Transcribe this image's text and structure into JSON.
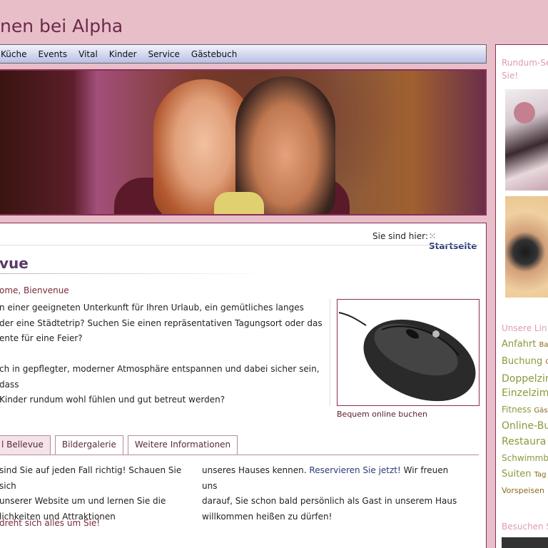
{
  "site": {
    "title": "nen bei Alpha"
  },
  "nav": {
    "items": [
      "Küche",
      "Events",
      "Vital",
      "Kinder",
      "Service",
      "Gästebuch"
    ]
  },
  "breadcrumb": {
    "label": "Sie sind hier:",
    "link": "Startseite"
  },
  "page": {
    "title": "vue",
    "subheading": "ome, Bienvenue",
    "intro_lines": [
      "n einer geeigneten Unterkunft für Ihren Urlaub, ein gemütliches langes",
      "der eine Städtetrip? Suchen Sie einen repräsentativen Tagungsort oder das",
      "ente für eine Feier?",
      "",
      "ch in gepflegter, moderner Atmosphäre entspannen und dabei sicher sein, dass",
      "Kinder rundum wohl fühlen und gut betreut werden?"
    ],
    "image_caption": "Bequem online buchen"
  },
  "tabs": [
    {
      "label": "l Bellevue",
      "active": true
    },
    {
      "label": "Bildergalerie",
      "active": false
    },
    {
      "label": "Weitere Informationen",
      "active": false
    }
  ],
  "tab_content": {
    "left_lines": [
      "sind Sie auf jeden Fall richtig! Schauen Sie sich",
      " unserer Website um und lernen Sie die",
      "lichkeiten und Attraktionen"
    ],
    "right_line1_prefix": "unseres Hauses kennen. ",
    "right_link": "Reservieren Sie jetzt!",
    "right_line1_suffix": " Wir freuen uns",
    "right_lines": [
      "darauf, Sie schon bald persönlich als Gast in unserem Haus",
      "willkommen heißen zu dürfen!"
    ],
    "tagline": "dreht sich alles um Sie!"
  },
  "sidebar": {
    "heading1_line1": "Rundum-Se",
    "heading1_line2": "Sie!",
    "heading2": "Unsere Lin",
    "heading3": "Besuchen S",
    "tags": [
      {
        "main": "Anfahrt",
        "small": "Ba"
      },
      {
        "main": "Buchung",
        "small": "O"
      },
      {
        "main": "Doppelzim",
        "small": ""
      },
      {
        "main": "Einzelzimm",
        "small": ""
      },
      {
        "main": "Fitness",
        "small": "Gäste"
      },
      {
        "main": "Online-Bu",
        "small": ""
      },
      {
        "main": "Restaura",
        "small": ""
      },
      {
        "main": "Schwimmb",
        "small": ""
      },
      {
        "main": "Suiten",
        "small": "Tag"
      },
      {
        "main": "Vorspeisen",
        "small": ""
      }
    ]
  },
  "colors": {
    "background": "#e8bec8",
    "accent": "#8a2e5a",
    "link": "#2a3a7a",
    "tag": "#8a9a3a"
  }
}
